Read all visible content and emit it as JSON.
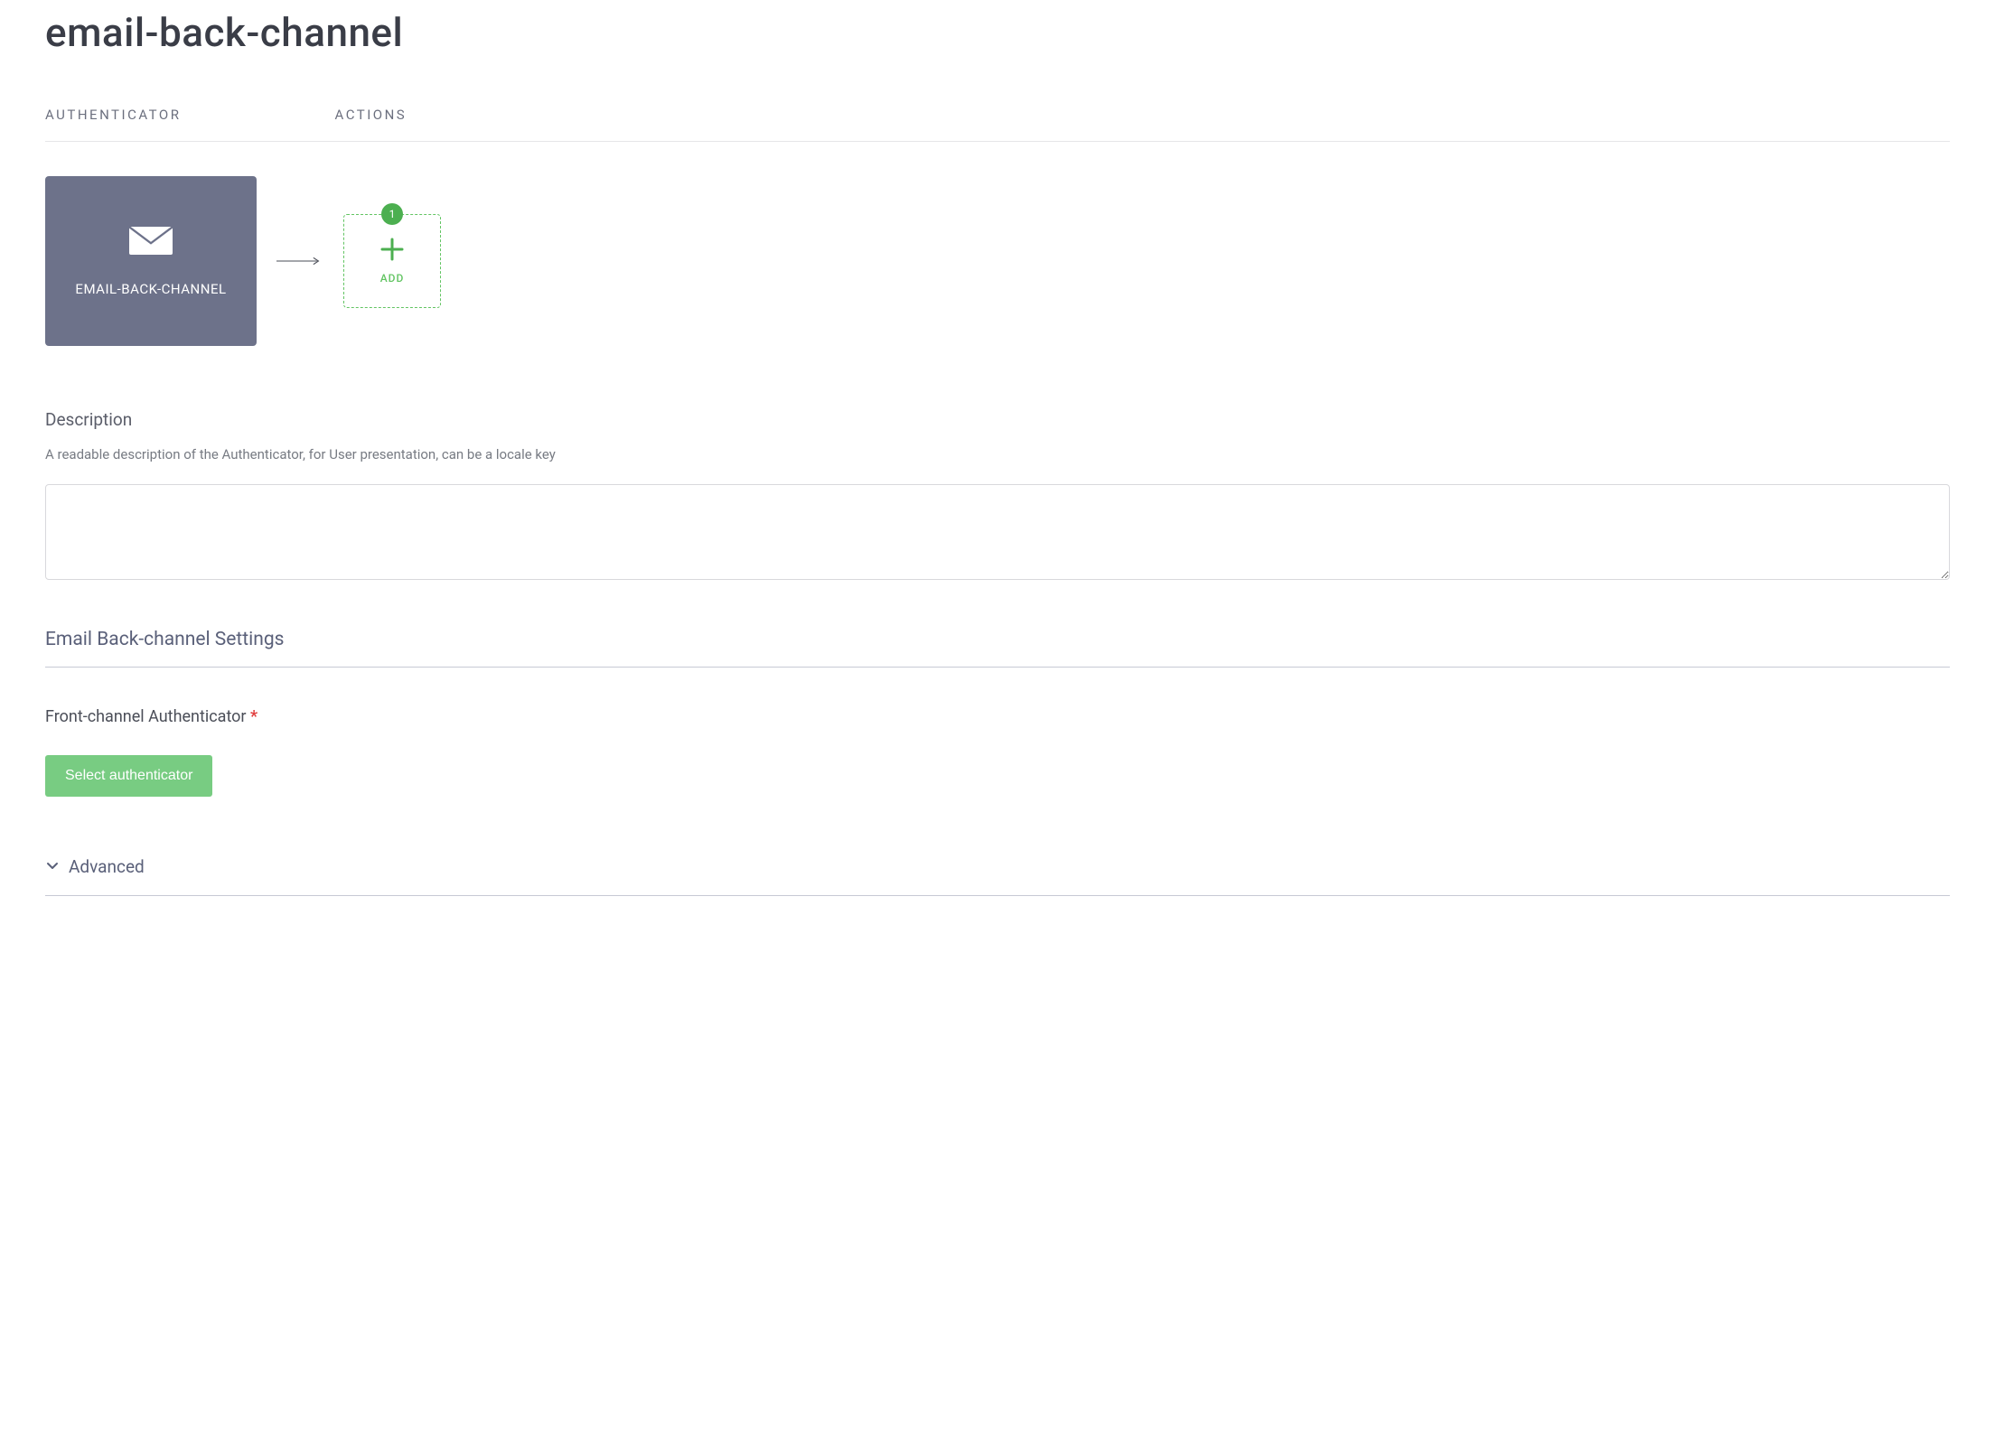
{
  "pageTitle": "email-back-channel",
  "tabs": {
    "authenticator": "Authenticator",
    "actions": "Actions"
  },
  "flow": {
    "nodeIcon": "envelope-icon",
    "nodeLabel": "EMAIL-BACK-CHANNEL",
    "addBadge": "1",
    "addLabel": "ADD"
  },
  "description": {
    "label": "Description",
    "help": "A readable description of the Authenticator, for User presentation, can be a locale key",
    "value": ""
  },
  "settingsTitle": "Email Back-channel Settings",
  "frontChannel": {
    "label": "Front-channel Authenticator",
    "required": "*",
    "buttonLabel": "Select authenticator"
  },
  "advanced": {
    "label": "Advanced"
  }
}
